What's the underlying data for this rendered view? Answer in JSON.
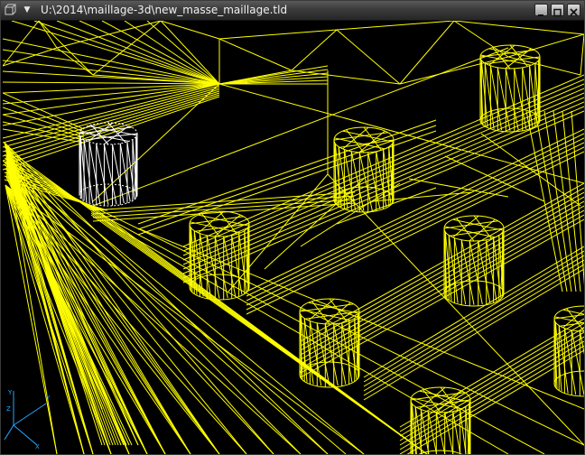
{
  "window": {
    "title": "U:\\2014\\maillage-3d\\new_masse_maillage.tld",
    "system_menu_glyph": "▼",
    "icons": {
      "app": "cube-wireframe-icon",
      "system_menu": "chevron-down-icon",
      "minimize": "minimize-icon",
      "maximize": "maximize-icon",
      "close": "close-icon"
    }
  },
  "viewport": {
    "render_mode": "wireframe",
    "background": "#000000",
    "mesh_color": "#ffff00",
    "highlight_color": "#ffffff"
  },
  "axis_triad": {
    "labels": [
      "Y",
      "Y",
      "X",
      "Z"
    ],
    "color": "#28a8ff"
  }
}
